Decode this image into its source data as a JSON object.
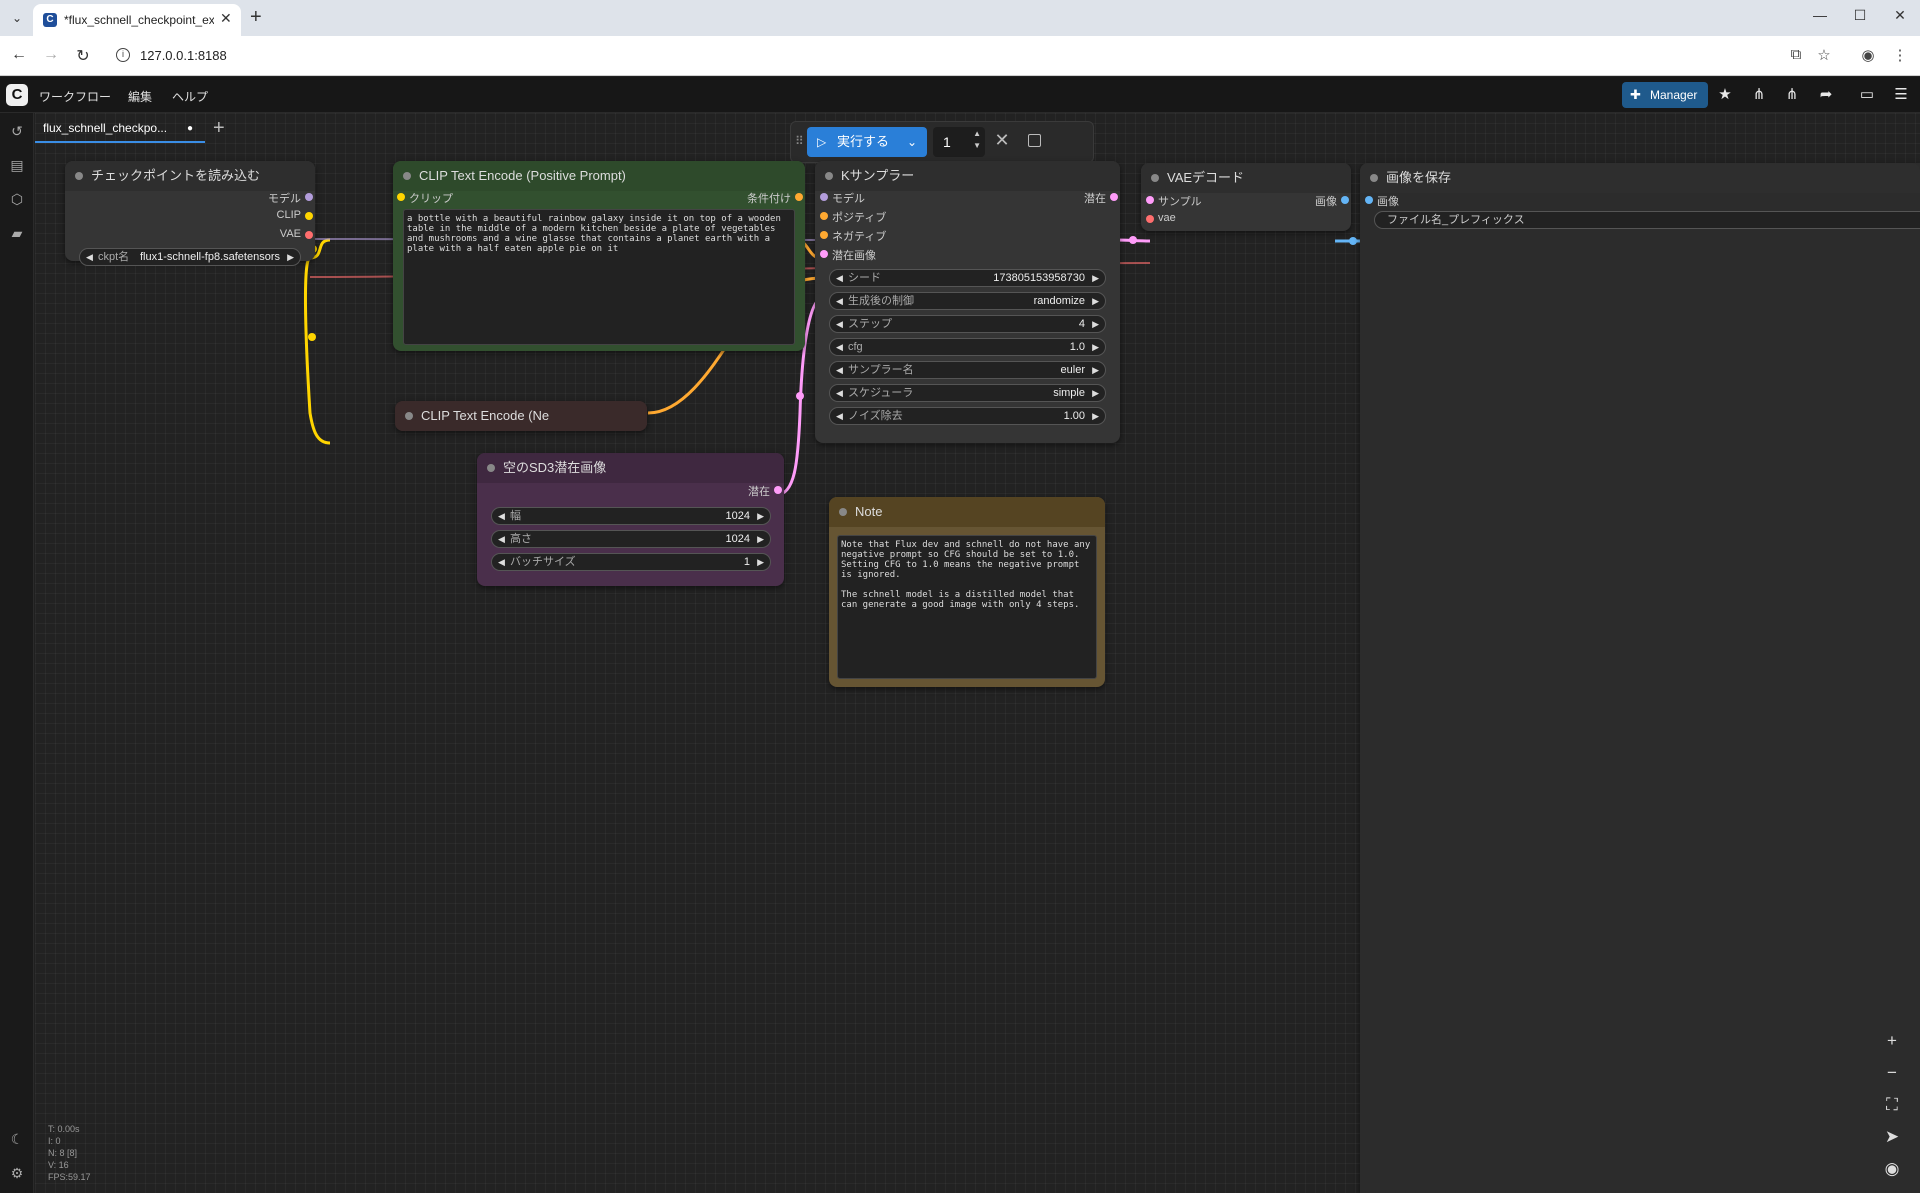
{
  "browser": {
    "tab_title": "*flux_schnell_checkpoint_example",
    "url": "127.0.0.1:8188",
    "favicon": "C"
  },
  "topbar": {
    "logo": "C",
    "menu": [
      "ワークフロー",
      "編集",
      "ヘルプ"
    ],
    "manager_label": "Manager"
  },
  "workflow_tab": {
    "label": "flux_schnell_checkpo...",
    "modified": "●"
  },
  "queue": {
    "run_label": "実行する",
    "count": "1"
  },
  "nodes": {
    "checkpoint": {
      "title": "チェックポイントを読み込む",
      "outputs": [
        "モデル",
        "CLIP",
        "VAE"
      ],
      "widget": {
        "label": "ckpt名",
        "value": "flux1-schnell-fp8.safetensors"
      }
    },
    "clip_pos": {
      "title": "CLIP Text Encode (Positive Prompt)",
      "input": "クリップ",
      "output": "条件付け",
      "text": "a bottle with a beautiful rainbow galaxy inside it on top of a wooden table in the middle of a modern kitchen beside a plate of vegetables and mushrooms and a wine glasse that contains a planet earth with a plate with a half eaten apple pie on it"
    },
    "clip_neg": {
      "title": "CLIP Text Encode (Ne"
    },
    "latent": {
      "title": "空のSD3潜在画像",
      "output": "潜在",
      "widgets": [
        {
          "label": "幅",
          "value": "1024"
        },
        {
          "label": "高さ",
          "value": "1024"
        },
        {
          "label": "バッチサイズ",
          "value": "1"
        }
      ]
    },
    "ksampler": {
      "title": "Kサンプラー",
      "inputs": [
        "モデル",
        "ポジティブ",
        "ネガティブ",
        "潜在画像"
      ],
      "output": "潜在",
      "widgets": [
        {
          "label": "シード",
          "value": "173805153958730"
        },
        {
          "label": "生成後の制御",
          "value": "randomize"
        },
        {
          "label": "ステップ",
          "value": "4"
        },
        {
          "label": "cfg",
          "value": "1.0"
        },
        {
          "label": "サンプラー名",
          "value": "euler"
        },
        {
          "label": "スケジューラ",
          "value": "simple"
        },
        {
          "label": "ノイズ除去",
          "value": "1.00"
        }
      ]
    },
    "note": {
      "title": "Note",
      "text": "Note that Flux dev and schnell do not have any negative prompt so CFG should be set to 1.0. Setting CFG to 1.0 means the negative prompt is ignored.\n\nThe schnell model is a distilled model that can generate a good image with only 4 steps."
    },
    "vae_decode": {
      "title": "VAEデコード",
      "inputs": [
        "サンプル",
        "vae"
      ],
      "output": "画像"
    },
    "save_image": {
      "title": "画像を保存",
      "input": "画像",
      "widget": {
        "label": "ファイル名_プレフィックス"
      }
    }
  },
  "stats": [
    "T: 0.00s",
    "I: 0",
    "N: 8 [8]",
    "V: 16",
    "FPS:59.17"
  ],
  "colors": {
    "model": "#b39ddb",
    "clip": "#ffd500",
    "vae": "#ff6e6e",
    "conditioning": "#ffa931",
    "latent": "#ff9cf9",
    "image": "#64b5f6",
    "accent": "#2a7fd8"
  }
}
